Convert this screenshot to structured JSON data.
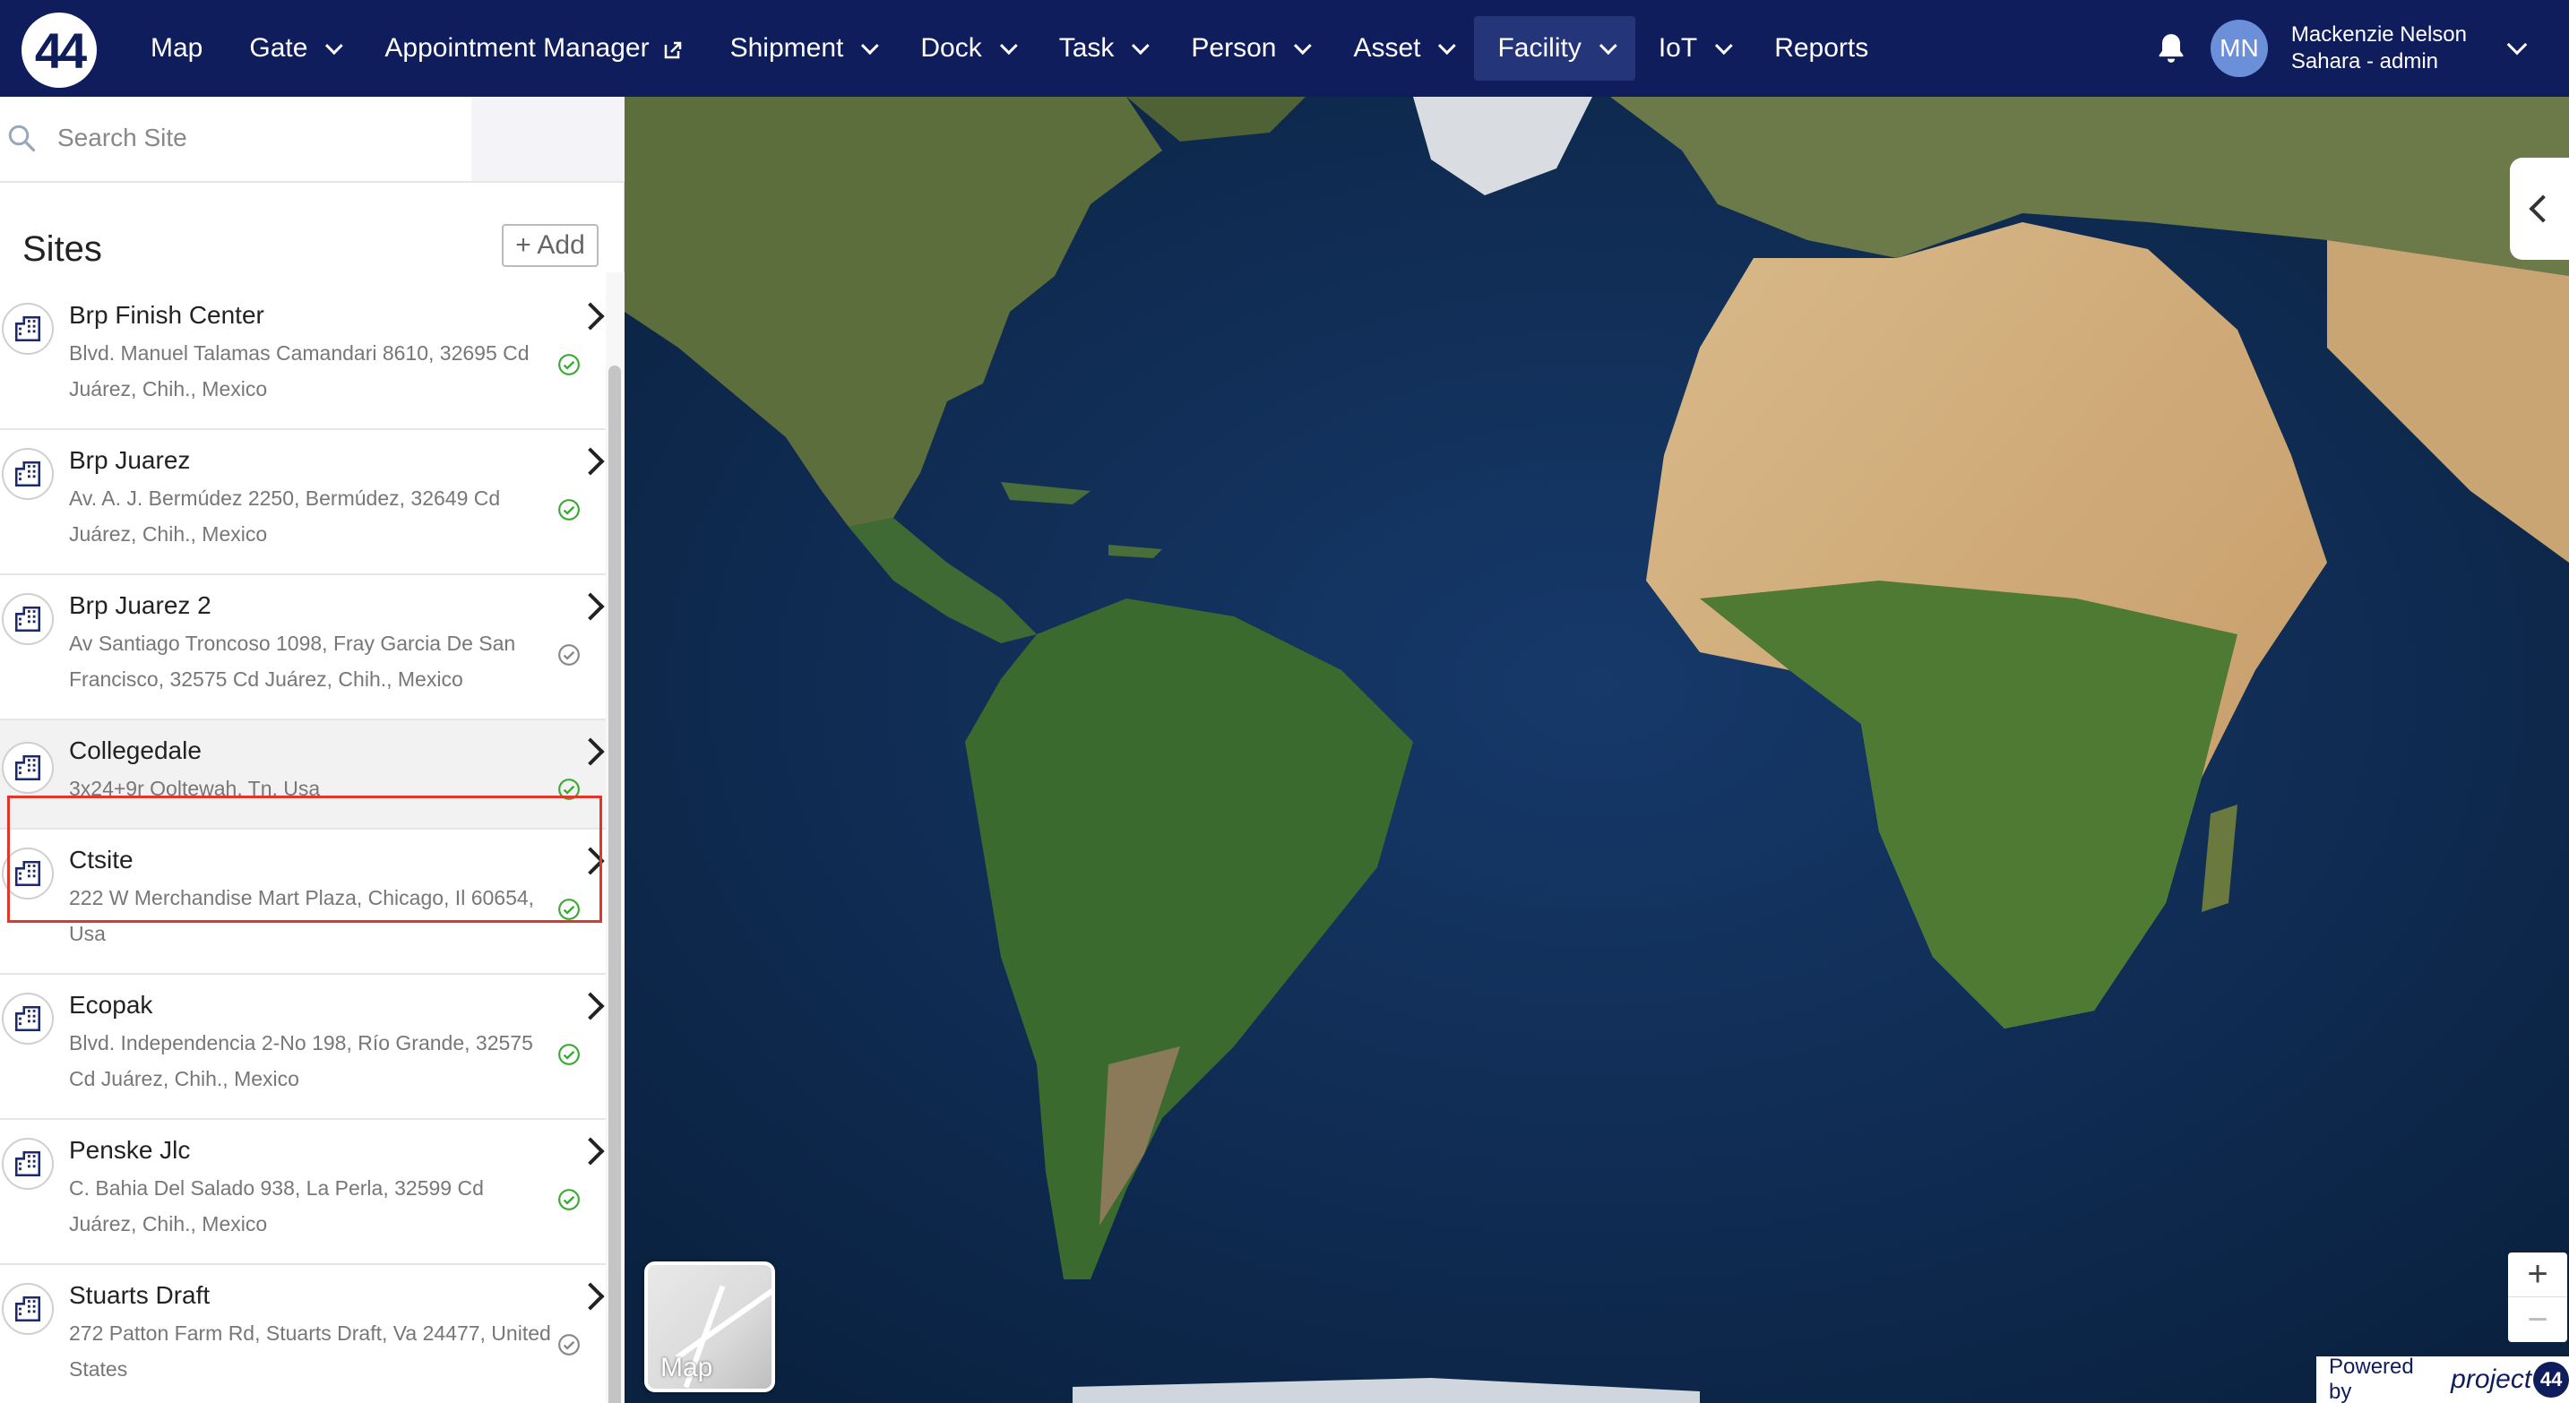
{
  "brand": {
    "logo_text": "44"
  },
  "nav": {
    "items": [
      {
        "label": "Map",
        "has_dropdown": false
      },
      {
        "label": "Gate",
        "has_dropdown": true
      },
      {
        "label": "Appointment Manager",
        "has_dropdown": false,
        "external": true
      },
      {
        "label": "Shipment",
        "has_dropdown": true
      },
      {
        "label": "Dock",
        "has_dropdown": true
      },
      {
        "label": "Task",
        "has_dropdown": true
      },
      {
        "label": "Person",
        "has_dropdown": true
      },
      {
        "label": "Asset",
        "has_dropdown": true
      },
      {
        "label": "Facility",
        "has_dropdown": true,
        "active": true
      },
      {
        "label": "IoT",
        "has_dropdown": true
      },
      {
        "label": "Reports",
        "has_dropdown": false
      }
    ]
  },
  "user": {
    "initials": "MN",
    "name": "Mackenzie Nelson",
    "role": "Sahara - admin"
  },
  "sidebar": {
    "search_placeholder": "Search Site",
    "title": "Sites",
    "add_label": "+ Add",
    "sites": [
      {
        "name": "Brp Finish Center",
        "address": "Blvd. Manuel Talamas Camandari 8610, 32695 Cd Juárez, Chih., Mexico",
        "active": true
      },
      {
        "name": "Brp Juarez",
        "address": "Av. A. J. Bermúdez 2250, Bermúdez, 32649 Cd Juárez, Chih., Mexico",
        "active": true
      },
      {
        "name": "Brp Juarez 2",
        "address": "Av Santiago Troncoso 1098, Fray Garcia De San Francisco, 32575 Cd Juárez, Chih., Mexico",
        "active": true
      },
      {
        "name": "Collegedale",
        "address": "3x24+9r Ooltewah, Tn, Usa",
        "active": true,
        "selected": true
      },
      {
        "name": "Ctsite",
        "address": "222 W Merchandise Mart Plaza, Chicago, Il 60654, Usa",
        "active": true
      },
      {
        "name": "Ecopak",
        "address": "Blvd. Independencia 2-No 198, Río Grande, 32575 Cd Juárez, Chih., Mexico",
        "active": true
      },
      {
        "name": "Penske Jlc",
        "address": "C. Bahia Del Salado 938, La Perla, 32599 Cd Juárez, Chih., Mexico",
        "active": true
      },
      {
        "name": "Stuarts Draft",
        "address": "272 Patton Farm Rd, Stuarts Draft, Va 24477, United States",
        "active": true
      }
    ]
  },
  "map": {
    "type_toggle_label": "Map",
    "zoom_in_label": "+",
    "zoom_out_label": "−",
    "powered_by": "Powered by",
    "powered_brand": "project",
    "powered_brand_badge": "44"
  },
  "colors": {
    "nav_bg": "#0f1d5c",
    "nav_active": "#24357a",
    "avatar": "#6b8fd9",
    "check_green": "#3aaa35",
    "highlight": "#e0362c",
    "ocean": "#0d2a52"
  }
}
